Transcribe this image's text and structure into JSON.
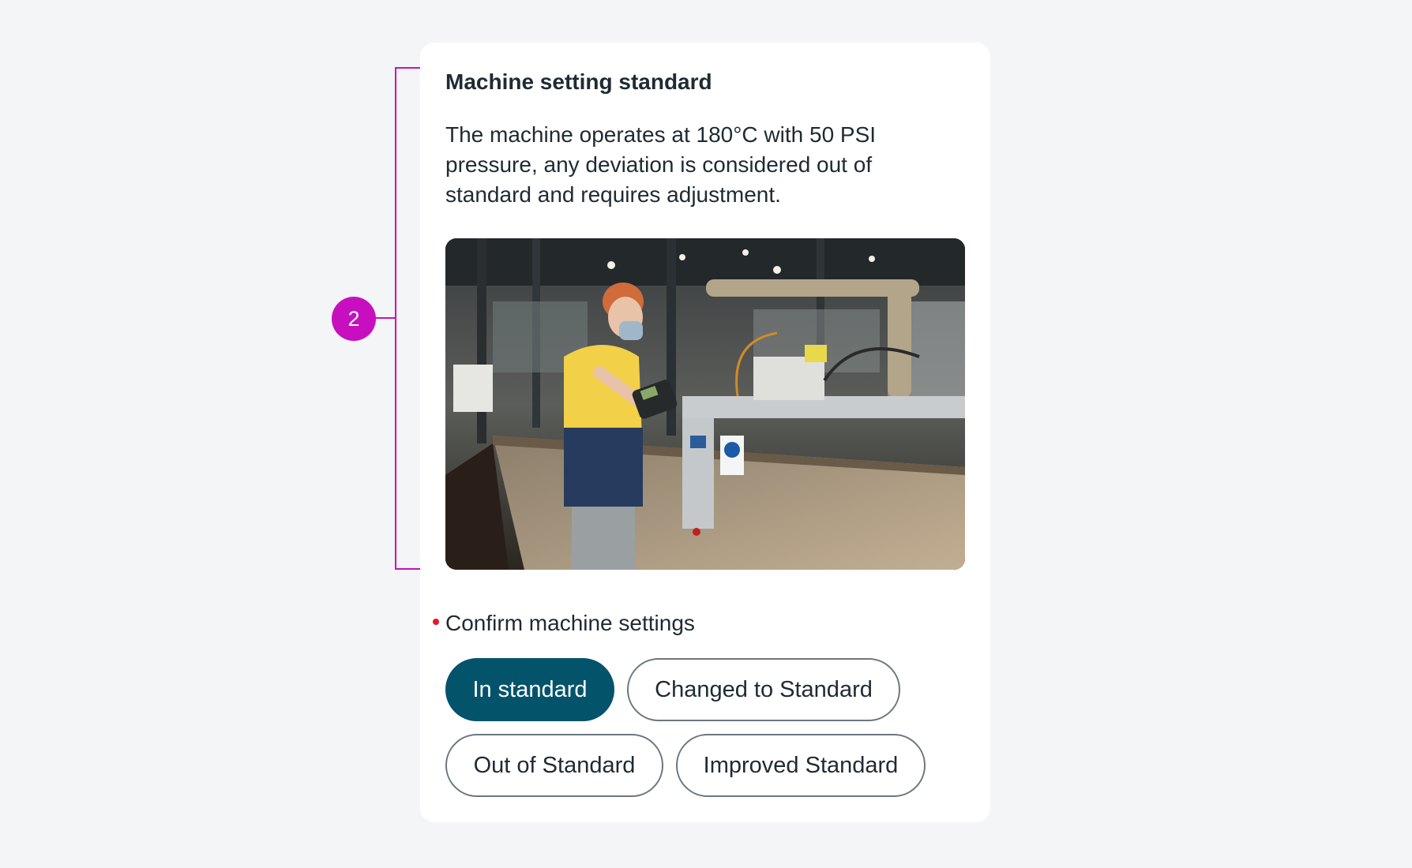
{
  "annotation": {
    "marker_number": "2",
    "color": "#c80fbf"
  },
  "card": {
    "title": "Machine setting standard",
    "description": "The machine operates at 180°C with 50 PSI pressure, any deviation is considered out of standard and requires adjustment.",
    "image_icon": "factory-worker-photo"
  },
  "question": {
    "label": "Confirm machine settings",
    "required": true,
    "required_color": "#e0192c",
    "options": [
      {
        "label": "In standard",
        "selected": true
      },
      {
        "label": "Changed to Standard",
        "selected": false
      },
      {
        "label": "Out of Standard",
        "selected": false
      },
      {
        "label": "Improved Standard",
        "selected": false
      }
    ],
    "selected_color": "#03536b"
  }
}
